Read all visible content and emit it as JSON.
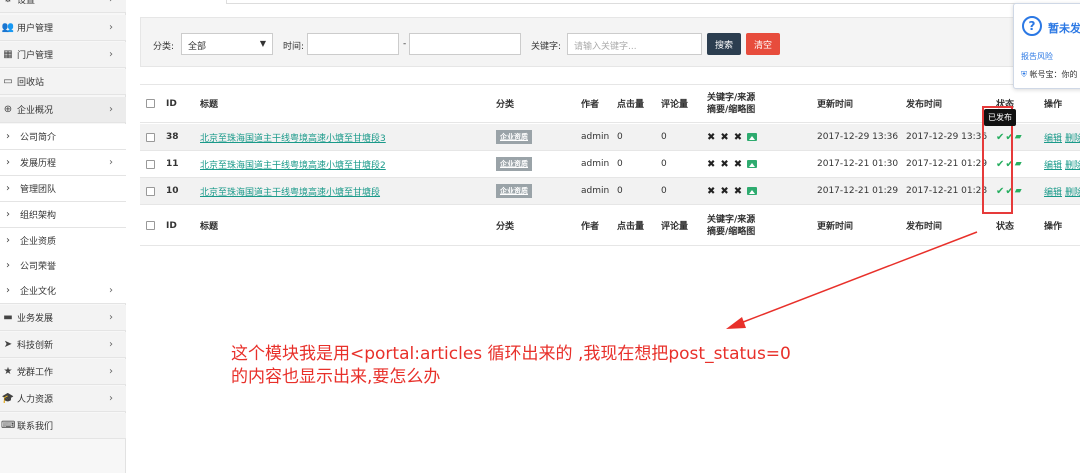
{
  "sidebar": {
    "items": [
      {
        "label": "设置",
        "icon": "gear-icon",
        "glyph": "⚙",
        "arrow": true,
        "sub": false
      },
      {
        "label": "用户管理",
        "icon": "users-icon",
        "glyph": "👥",
        "arrow": true,
        "sub": false
      },
      {
        "label": "门户管理",
        "icon": "grid-icon",
        "glyph": "▦",
        "arrow": true,
        "sub": false
      },
      {
        "label": "回收站",
        "icon": "trash-icon",
        "glyph": "▭",
        "arrow": false,
        "sub": false
      },
      {
        "label": "企业概况",
        "icon": "globe-icon",
        "glyph": "⊕",
        "arrow": true,
        "sub": false,
        "active": true
      },
      {
        "label": "公司简介",
        "icon": "caret-right-icon",
        "glyph": "›",
        "arrow": false,
        "sub": true
      },
      {
        "label": "发展历程",
        "icon": "caret-right-icon",
        "glyph": "›",
        "arrow": true,
        "sub": true
      },
      {
        "label": "管理团队",
        "icon": "caret-right-icon",
        "glyph": "›",
        "arrow": false,
        "sub": true
      },
      {
        "label": "组织架构",
        "icon": "caret-right-icon",
        "glyph": "›",
        "arrow": false,
        "sub": true
      },
      {
        "label": "企业资质",
        "icon": "caret-right-icon",
        "glyph": "›",
        "arrow": false,
        "sub": true
      },
      {
        "label": "公司荣誉",
        "icon": "caret-right-icon",
        "glyph": "›",
        "arrow": false,
        "sub": true
      },
      {
        "label": "企业文化",
        "icon": "caret-right-icon",
        "glyph": "›",
        "arrow": true,
        "sub": true
      },
      {
        "label": "业务发展",
        "icon": "briefcase-icon",
        "glyph": "▬",
        "arrow": true,
        "sub": false
      },
      {
        "label": "科技创新",
        "icon": "send-icon",
        "glyph": "➤",
        "arrow": true,
        "sub": false
      },
      {
        "label": "党群工作",
        "icon": "star-icon",
        "glyph": "★",
        "arrow": true,
        "sub": false
      },
      {
        "label": "人力资源",
        "icon": "graduation-cap-icon",
        "glyph": "🎓",
        "arrow": true,
        "sub": false
      },
      {
        "label": "联系我们",
        "icon": "keyboard-icon",
        "glyph": "⌨",
        "arrow": false,
        "sub": false
      }
    ]
  },
  "filter": {
    "category_label": "分类:",
    "category_value": "全部",
    "time_label": "时间:",
    "time_separator": "-",
    "keyword_label": "关键字:",
    "keyword_placeholder": "请输入关键字...",
    "search_button": "搜索",
    "clear_button": "清空"
  },
  "table": {
    "headers": {
      "id": "ID",
      "title": "标题",
      "category": "分类",
      "author": "作者",
      "hits": "点击量",
      "comments": "评论量",
      "keyword_line1": "关键字/来源",
      "keyword_line2": "摘要/缩略图",
      "update_time": "更新时间",
      "publish_time": "发布时间",
      "status": "状态",
      "actions": "操作"
    },
    "rows": [
      {
        "id": "38",
        "title": "北京至珠海国道主干线粤境高速小塘至甘塘段3",
        "category": "企业资质",
        "author": "admin",
        "hits": "0",
        "comments": "0",
        "update_time": "2017-12-29 13:36",
        "publish_time": "2017-12-29 13:36",
        "edit": "编辑",
        "delete": "删除"
      },
      {
        "id": "11",
        "title": "北京至珠海国道主干线粤境高速小塘至甘塘段2",
        "category": "企业资质",
        "author": "admin",
        "hits": "0",
        "comments": "0",
        "update_time": "2017-12-21 01:30",
        "publish_time": "2017-12-21 01:29",
        "edit": "编辑",
        "delete": "删除"
      },
      {
        "id": "10",
        "title": "北京至珠海国道主干线粤境高速小塘至甘塘段",
        "category": "企业资质",
        "author": "admin",
        "hits": "0",
        "comments": "0",
        "update_time": "2017-12-21 01:29",
        "publish_time": "2017-12-21 01:28",
        "edit": "编辑",
        "delete": "删除"
      }
    ]
  },
  "tooltip": "已发布",
  "notification": {
    "title": "暂未发",
    "link": "报告风险",
    "footer": "帐号宝：你的"
  },
  "annotation": {
    "line1": "这个模块我是用<portal:articles 循环出来的 ,我现在想把post_status=0",
    "line2": "的内容也显示出来,要怎么办"
  },
  "colors": {
    "annotation": "#e8302a",
    "search_button": "#2c3e50",
    "clear_button": "#e74c3c",
    "link": "#1a9a8a",
    "status": "#27ae60"
  }
}
